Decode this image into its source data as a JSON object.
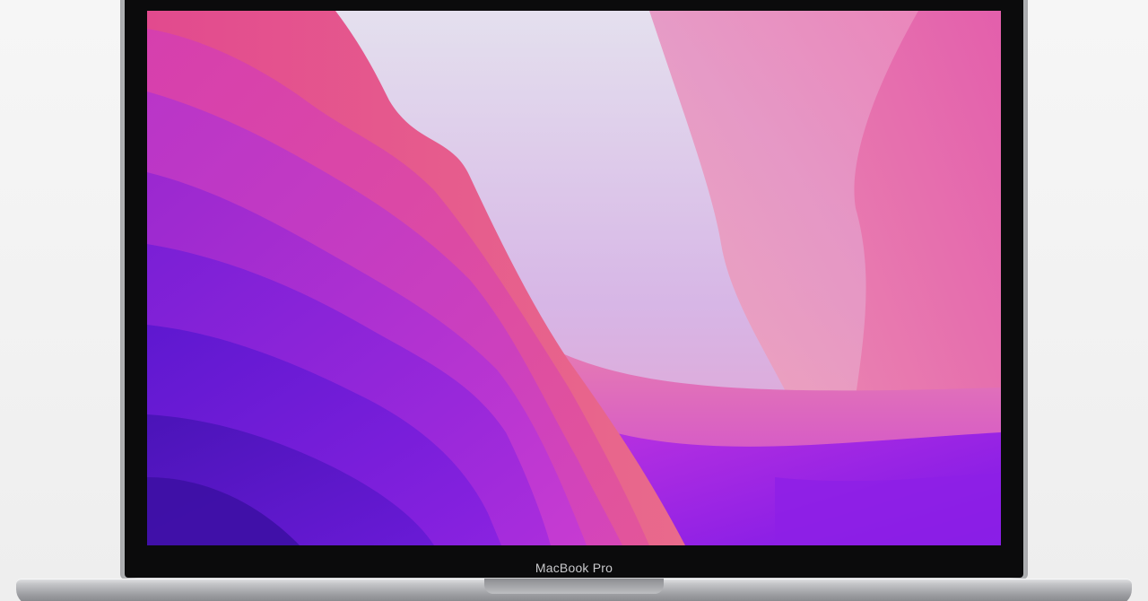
{
  "device": {
    "model_label": "MacBook Pro"
  },
  "colors": {
    "bezel": "#0b0b0c",
    "aluminium": "#c9cacd",
    "wallpaper_magenta": "#c53fd6",
    "wallpaper_violet": "#6a1fe0",
    "wallpaper_pink": "#e874b2",
    "wallpaper_light": "#d9d3ea"
  },
  "wallpaper": {
    "name_icon": "abstract-wave-wallpaper"
  }
}
